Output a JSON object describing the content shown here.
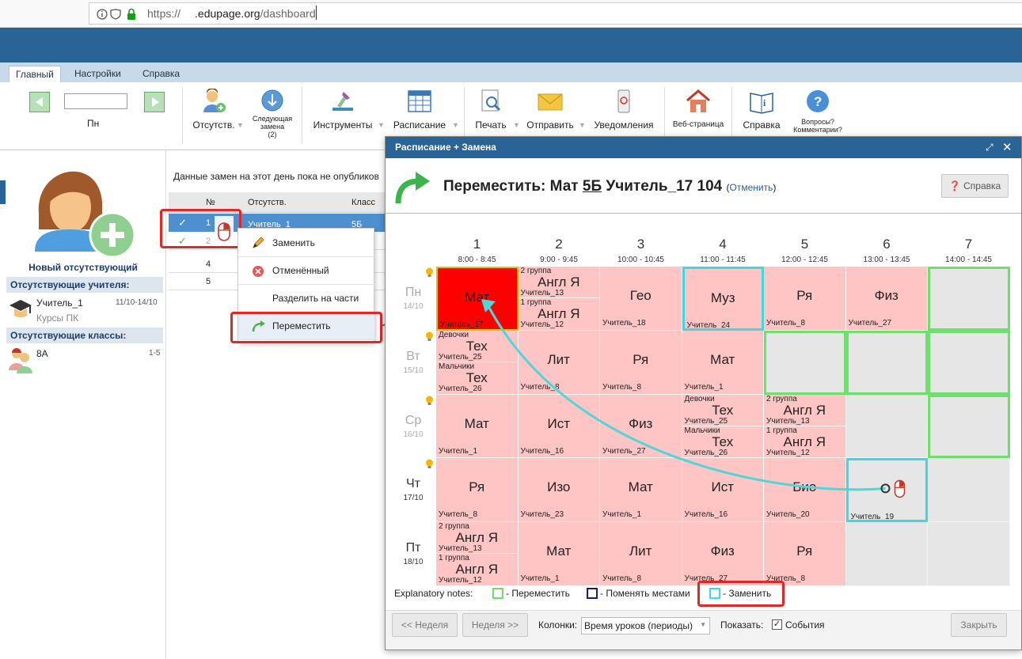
{
  "browser": {
    "url_prefix": "https://",
    "url_host": ".edupage.org",
    "url_path": "/dashboard"
  },
  "tabs": [
    {
      "label": "Главный"
    },
    {
      "label": "Настройки"
    },
    {
      "label": "Справка"
    }
  ],
  "ribbon": {
    "day_label": "Пн",
    "absent": "Отсутств.",
    "next_sub_1": "Следующая",
    "next_sub_2": "замена",
    "next_sub_3": "(2)",
    "tools": "Инструменты",
    "timetable": "Расписание",
    "print": "Печать",
    "send": "Отправить",
    "notifications": "Уведомления",
    "web": "Веб-страница",
    "help": "Справка",
    "questions_1": "Вопросы?",
    "questions_2": "Комментарии?"
  },
  "sidebar": {
    "new_absent": "Новый отсутствующий",
    "absent_teachers_title": "Отсутствующие учителя:",
    "teacher_name": "Учитель_1",
    "teacher_dates": "11/10-14/10",
    "teacher_reason": "Курсы ПК",
    "absent_classes_title": "Отсутствующие классы:",
    "class_name": "8А",
    "class_periods": "1-5"
  },
  "center": {
    "notice": "Данные замен на этот день пока не опубликов",
    "col_no": "№",
    "col_absent": "Отсутств.",
    "col_class": "Класс",
    "rows": [
      {
        "no": "1",
        "absent": "Учитель_1",
        "class": "5Б"
      },
      {
        "no": "2",
        "absent": "",
        "class": ""
      },
      {
        "no": "4",
        "absent": "",
        "class": ""
      },
      {
        "no": "5",
        "absent": "",
        "class": ""
      }
    ]
  },
  "context_menu": [
    {
      "label": "Заменить"
    },
    {
      "label": "Отменённый"
    },
    {
      "label": "Разделить на части"
    },
    {
      "label": "Переместить"
    }
  ],
  "modal": {
    "title": "Расписание + Замена",
    "move_prefix": "Переместить: Мат",
    "move_class": "5Б",
    "move_rest": "Учитель_17 104",
    "cancel_link": "Отменить",
    "help_button": "Справка",
    "periods": [
      {
        "num": "1",
        "time": "8:00 - 8:45"
      },
      {
        "num": "2",
        "time": "9:00 - 9:45"
      },
      {
        "num": "3",
        "time": "10:00 - 10:45"
      },
      {
        "num": "4",
        "time": "11:00 - 11:45"
      },
      {
        "num": "5",
        "time": "12:00 - 12:45"
      },
      {
        "num": "6",
        "time": "13:00 - 13:45"
      },
      {
        "num": "7",
        "time": "14:00 - 14:45"
      }
    ],
    "days": [
      {
        "name": "Пн",
        "date": "14/10"
      },
      {
        "name": "Вт",
        "date": "15/10"
      },
      {
        "name": "Ср",
        "date": "16/10"
      },
      {
        "name": "Чт",
        "date": "17/10"
      },
      {
        "name": "Пт",
        "date": "18/10"
      }
    ],
    "grid": [
      [
        {
          "subject": "Мат",
          "teacher": "Учитель_17",
          "state": "selected"
        },
        {
          "halves": [
            {
              "group": "2 группа",
              "subject": "Англ Я",
              "teacher": "Учитель_13"
            },
            {
              "group": "1 группа",
              "subject": "Англ Я",
              "teacher": "Учитель_12"
            }
          ]
        },
        {
          "subject": "Гео",
          "teacher": "Учитель_18"
        },
        {
          "subject": "Муз",
          "teacher": "Учитель_24",
          "state": "cyan"
        },
        {
          "subject": "Ря",
          "teacher": "Учитель_8"
        },
        {
          "subject": "Физ",
          "teacher": "Учитель_27"
        },
        {
          "empty": true,
          "state": "green"
        }
      ],
      [
        {
          "halves": [
            {
              "group": "Девочки",
              "subject": "Тех",
              "teacher": "Учитель_25"
            },
            {
              "group": "Мальчики",
              "subject": "Тех",
              "teacher": "Учитель_26"
            }
          ]
        },
        {
          "subject": "Лит",
          "teacher": "Учитель_8"
        },
        {
          "subject": "Ря",
          "teacher": "Учитель_8"
        },
        {
          "subject": "Мат",
          "teacher": "Учитель_1"
        },
        {
          "empty": true,
          "state": "green"
        },
        {
          "empty": true,
          "state": "green"
        },
        {
          "empty": true,
          "state": "green"
        }
      ],
      [
        {
          "subject": "Мат",
          "teacher": "Учитель_1"
        },
        {
          "subject": "Ист",
          "teacher": "Учитель_16"
        },
        {
          "subject": "Физ",
          "teacher": "Учитель_27"
        },
        {
          "halves": [
            {
              "group": "Девочки",
              "subject": "Тех",
              "teacher": "Учитель_25"
            },
            {
              "group": "Мальчики",
              "subject": "Тех",
              "teacher": "Учитель_26"
            }
          ]
        },
        {
          "halves": [
            {
              "group": "2 группа",
              "subject": "Англ Я",
              "teacher": "Учитель_13"
            },
            {
              "group": "1 группа",
              "subject": "Англ Я",
              "teacher": "Учитель_12"
            }
          ]
        },
        {
          "empty": true
        },
        {
          "empty": true,
          "state": "green"
        }
      ],
      [
        {
          "subject": "Ря",
          "teacher": "Учитель_8"
        },
        {
          "subject": "Изо",
          "teacher": "Учитель_23"
        },
        {
          "subject": "Мат",
          "teacher": "Учитель_1"
        },
        {
          "subject": "Ист",
          "teacher": "Учитель_16"
        },
        {
          "subject": "Био",
          "teacher": "Учитель_20"
        },
        {
          "empty": true,
          "state": "cyan",
          "teacher": "Учитель_19"
        },
        {
          "empty": true
        }
      ],
      [
        {
          "halves": [
            {
              "group": "2 группа",
              "subject": "Англ Я",
              "teacher": "Учитель_13"
            },
            {
              "group": "1 группа",
              "subject": "Англ Я",
              "teacher": "Учитель_12"
            }
          ]
        },
        {
          "subject": "Мат",
          "teacher": "Учитель_1"
        },
        {
          "subject": "Лит",
          "teacher": "Учитель_8"
        },
        {
          "subject": "Физ",
          "teacher": "Учитель_27"
        },
        {
          "subject": "Ря",
          "teacher": "Учитель_8"
        },
        {
          "empty": true
        },
        {
          "empty": true
        }
      ]
    ],
    "notes_label": "Explanatory notes:",
    "note_move": "- Переместить",
    "note_swap": "- Поменять местами",
    "note_replace": "- Заменить",
    "prev_week": "<< Неделя",
    "next_week": "Неделя >>",
    "columns_label": "Колонки:",
    "columns_value": "Время уроков (периоды)",
    "show_label": "Показать:",
    "events_label": "События",
    "close": "Закрыть"
  },
  "colors": {
    "header_blue": "#2a6395",
    "lesson_pink": "#ffc4c4",
    "selected_red": "#ff0000",
    "move_green": "#6de06d",
    "swap_navy": "#1a1a80",
    "replace_cyan": "#3dd8e0",
    "annotation_red": "#e02828"
  }
}
